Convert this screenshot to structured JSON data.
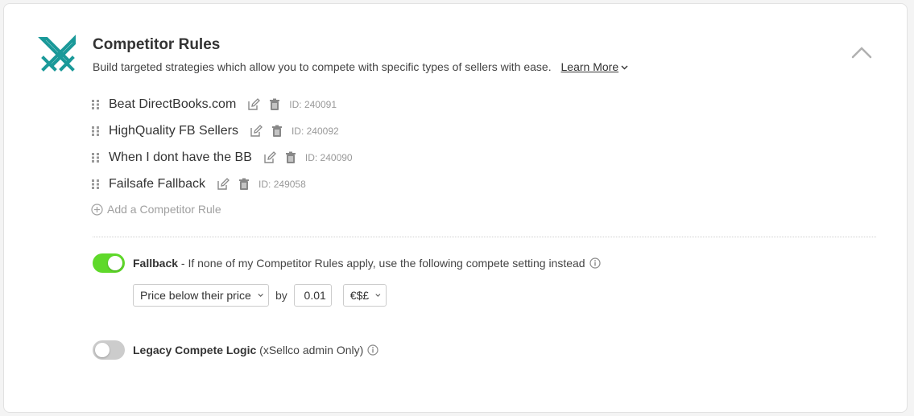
{
  "colors": {
    "accent": "#1a9999",
    "toggle_on": "#5fd92a",
    "toggle_off": "#cccccc"
  },
  "header": {
    "icon": "crossed-swords-icon",
    "title": "Competitor Rules",
    "subtitle": "Build targeted strategies which allow you to compete with specific types of sellers with ease.",
    "learn_more": "Learn More"
  },
  "rules": [
    {
      "name": "Beat DirectBooks.com",
      "id": "ID: 240091"
    },
    {
      "name": "HighQuality FB Sellers",
      "id": "ID: 240092"
    },
    {
      "name": "When I dont have the BB",
      "id": "ID: 240090"
    },
    {
      "name": "Failsafe Fallback",
      "id": "ID: 249058"
    }
  ],
  "add_rule_label": "Add a Competitor Rule",
  "fallback": {
    "enabled": true,
    "label": "Fallback",
    "description": " - If none of my Competitor Rules apply, use the following compete setting instead",
    "strategy": "Price below their price",
    "by_label": "by",
    "amount": "0.01",
    "currency": "€$£"
  },
  "legacy": {
    "enabled": false,
    "label": "Legacy Compete Logic",
    "note": " (xSellco admin Only)"
  }
}
